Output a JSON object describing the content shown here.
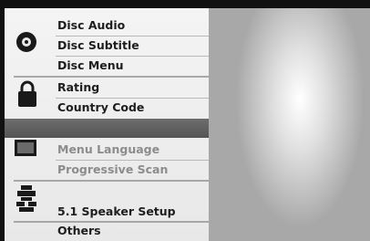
{
  "menu": {
    "groups": [
      {
        "icon": "disc-icon",
        "items": [
          {
            "label": "Disc Audio"
          },
          {
            "label": "Disc Subtitle"
          },
          {
            "label": "Disc Menu"
          }
        ]
      },
      {
        "icon": "padlock-icon",
        "items": [
          {
            "label": "Rating"
          },
          {
            "label": "Country Code"
          }
        ]
      },
      {
        "icon": "monitor-icon",
        "items": [
          {
            "label": "Menu Language"
          },
          {
            "label": "Progressive Scan"
          }
        ]
      },
      {
        "icon": "speaker-icon",
        "items": [
          {
            "label": "5.1 Speaker Setup"
          }
        ]
      },
      {
        "icon": "",
        "items": [
          {
            "label": "Others"
          }
        ]
      }
    ]
  },
  "colors": {
    "menu_bg": "#f0f0f0",
    "selected_bar": "#5f5f5f",
    "text": "#1e1e1e",
    "dim_text": "#8c8c8c"
  }
}
